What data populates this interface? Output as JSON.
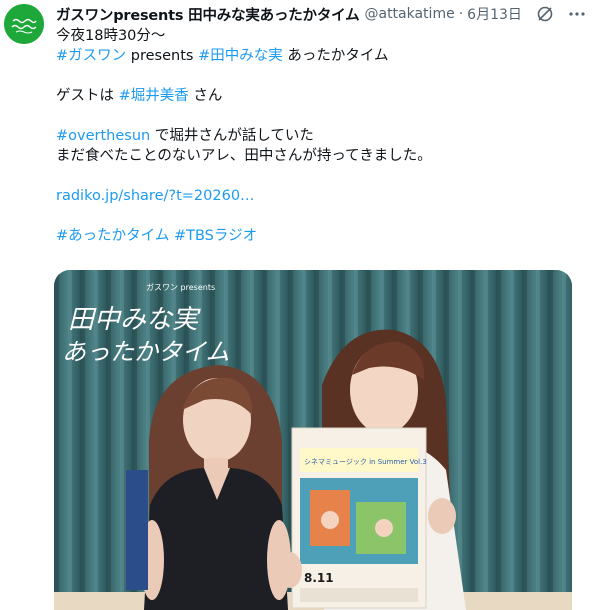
{
  "author": {
    "display_name": "ガスワンpresents 田中みな実あったかタイム",
    "handle": "@attakatime",
    "separator": "·",
    "date": "6月13日",
    "avatar_icon": "program-logo-avatar",
    "avatar_color": "#1fa83a"
  },
  "header_icons": [
    "grok-icon",
    "more-icon"
  ],
  "body": {
    "line1": "今夜18時30分〜",
    "tag_gaswan": "#ガスワン",
    "presents": " presents ",
    "tag_tanaka": "#田中みな実",
    "attaka": " あったかタイム",
    "guest_prefix": "ゲストは ",
    "tag_horii": "#堀井美香",
    "guest_suffix": " さん",
    "tag_overthesun": "#overthesun",
    "overthesun_text": " で堀井さんが話していた",
    "line6": "まだ食べたことのないアレ、田中さんが持ってきました。",
    "link": "radiko.jp/share/?t=20260…",
    "tag_attaka": "#あったかタイム",
    "tag_tbs": "#TBSラジオ"
  },
  "media": {
    "overlay_small": "ガスワン presents",
    "overlay_line1": "田中みな実",
    "overlay_line2": "あったかタイム",
    "poster_title": "シネマミュージック in Summer Vol.3",
    "poster_date": "8.11",
    "curtain_color": "#3e6c70"
  },
  "colors": {
    "link": "#1d9bf0",
    "text": "#0f1419",
    "muted": "#536471"
  }
}
